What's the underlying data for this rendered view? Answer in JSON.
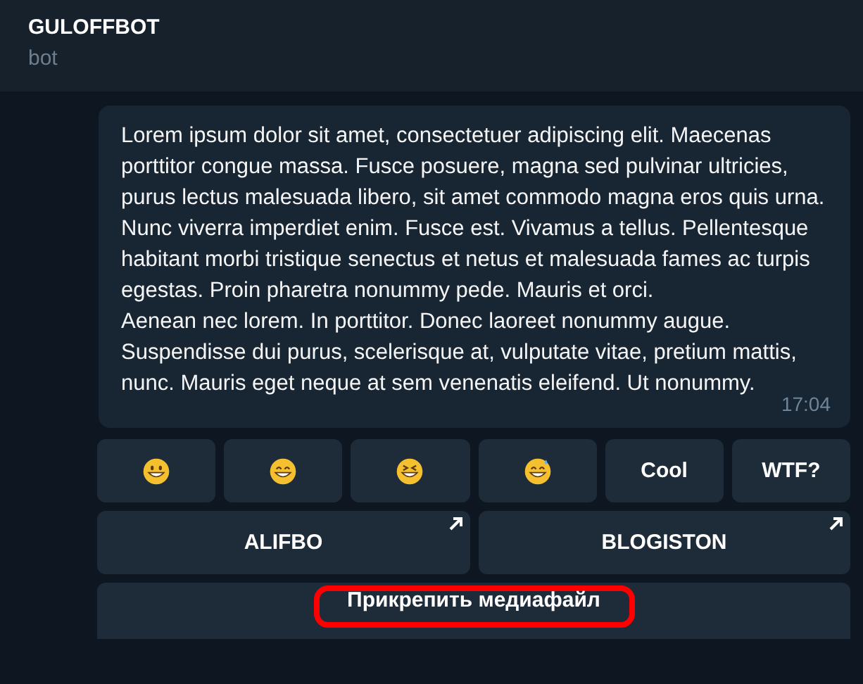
{
  "header": {
    "title": "GULOFFBOT",
    "subtitle": "bot"
  },
  "message": {
    "paragraphs": [
      "Lorem ipsum dolor sit amet, consectetuer adipiscing elit. Maecenas porttitor congue massa. Fusce posuere, magna sed pulvinar ultricies, purus lectus malesuada libero, sit amet commodo magna eros quis urna.",
      "Nunc viverra imperdiet enim. Fusce est. Vivamus a tellus. Pellentesque habitant morbi tristique senectus et netus et malesuada fames ac turpis egestas. Proin pharetra nonummy pede. Mauris et orci.",
      "Aenean nec lorem. In porttitor. Donec laoreet nonummy augue. Suspendisse dui purus, scelerisque at, vulputate vitae, pretium mattis, nunc. Mauris eget neque at sem venenatis eleifend. Ut nonummy."
    ],
    "time": "17:04"
  },
  "keyboard": [
    [
      {
        "kind": "smile"
      },
      {
        "kind": "grin"
      },
      {
        "kind": "squint"
      },
      {
        "kind": "sweat"
      },
      {
        "kind": "text",
        "label": "Cool"
      },
      {
        "kind": "text",
        "label": "WTF?"
      }
    ],
    [
      {
        "kind": "link",
        "label": "ALIFBO"
      },
      {
        "kind": "link",
        "label": "BLOGISTON"
      }
    ],
    [
      {
        "kind": "text",
        "label": "Прикрепить медиафайл",
        "highlighted": true
      }
    ]
  ]
}
